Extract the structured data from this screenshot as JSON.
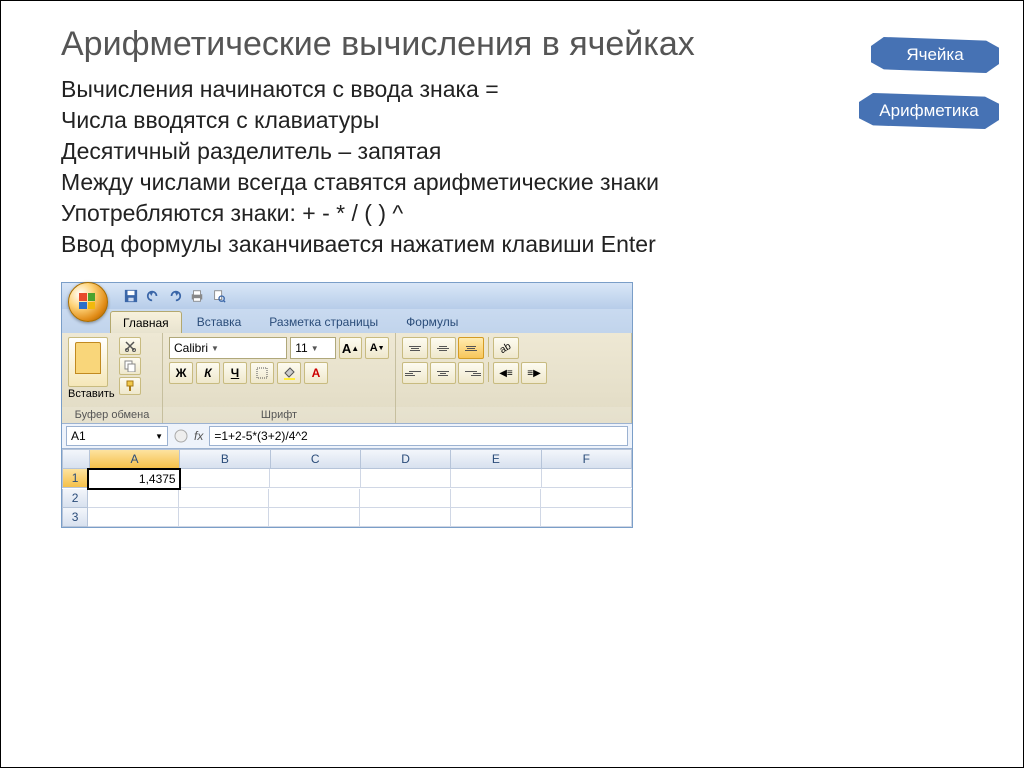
{
  "slide": {
    "title": "Арифметические вычисления в ячейках",
    "bullets": [
      "Вычисления начинаются с ввода знака =",
      "Числа вводятся с клавиатуры",
      "Десятичный разделитель – запятая",
      "Между числами всегда ставятся арифметические знаки",
      "Употребляются знаки: + - * / ( ) ^",
      "Ввод формулы заканчивается нажатием клавиши Enter"
    ],
    "banners": {
      "top": "Ячейка",
      "bottom": "Арифметика"
    }
  },
  "excel": {
    "tabs": [
      "Главная",
      "Вставка",
      "Разметка страницы",
      "Формулы"
    ],
    "active_tab": 0,
    "qat_icons": [
      "save-icon",
      "undo-icon",
      "redo-icon",
      "quick-print-icon",
      "print-preview-icon"
    ],
    "clipboard": {
      "paste": "Вставить",
      "group_label": "Буфер обмена"
    },
    "font": {
      "family": "Calibri",
      "size": "11",
      "buttons": {
        "bold": "Ж",
        "italic": "К",
        "underline": "Ч"
      },
      "group_label": "Шрифт"
    },
    "align_group_label": "",
    "namebox": "A1",
    "fx_label": "fx",
    "formula": "=1+2-5*(3+2)/4^2",
    "columns": [
      "A",
      "B",
      "C",
      "D",
      "E",
      "F"
    ],
    "rows": [
      "1",
      "2",
      "3"
    ],
    "cells": {
      "A1": "1,4375"
    }
  }
}
